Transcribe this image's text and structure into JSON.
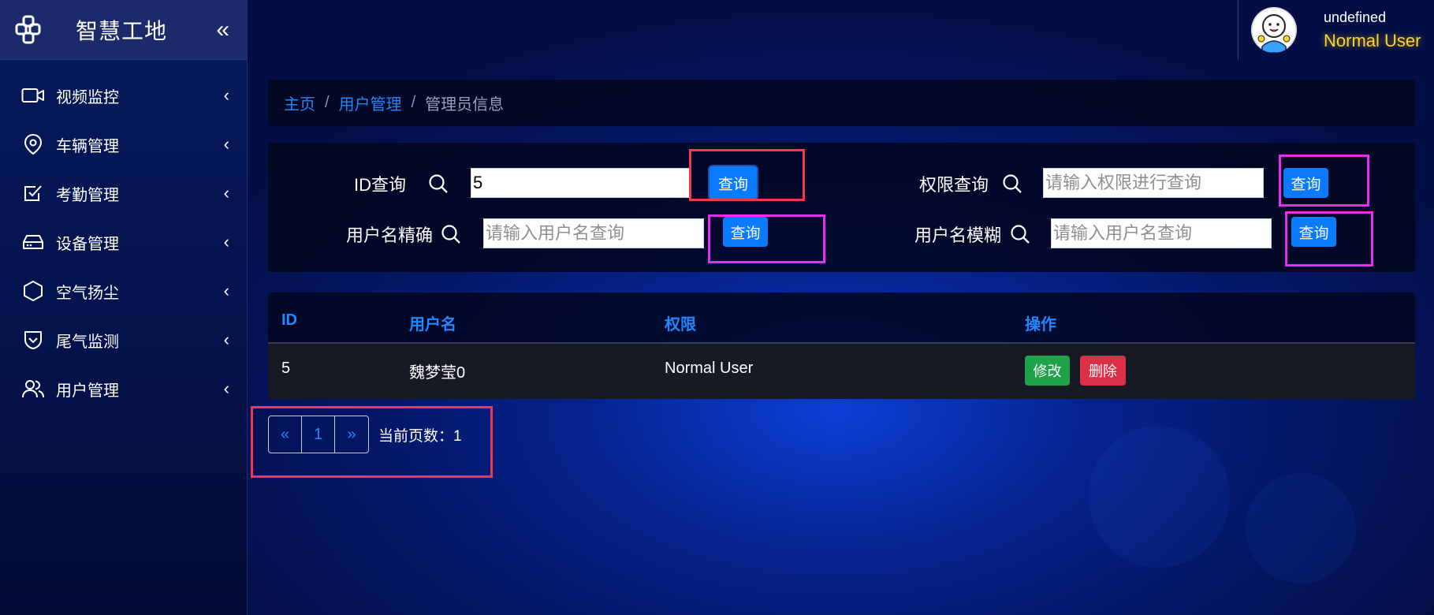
{
  "app": {
    "title": "智慧工地",
    "collapse_symbol": "«",
    "colors": {
      "accent": "#1e88ff",
      "brand_bg": "#1b2a6b",
      "warning": "#ffd42a",
      "success": "#1fa24a",
      "danger": "#dd2e48"
    }
  },
  "sidebar": {
    "items": [
      {
        "label": "视频监控",
        "icon": "video-camera-icon"
      },
      {
        "label": "车辆管理",
        "icon": "location-pin-icon"
      },
      {
        "label": "考勤管理",
        "icon": "checkbox-icon"
      },
      {
        "label": "设备管理",
        "icon": "device-drive-icon"
      },
      {
        "label": "空气扬尘",
        "icon": "hexagon-icon"
      },
      {
        "label": "尾气监测",
        "icon": "shield-check-icon"
      },
      {
        "label": "用户管理",
        "icon": "users-icon"
      }
    ],
    "chevron": "‹"
  },
  "user": {
    "name": "undefined",
    "role": "Normal User",
    "avatar_icon": "cartoon-avatar-icon"
  },
  "breadcrumb": {
    "home": "主页",
    "section": "用户管理",
    "current": "管理员信息",
    "separator": "/"
  },
  "search": {
    "id": {
      "label": "ID查询",
      "value": "5",
      "button": "查询"
    },
    "permission": {
      "label": "权限查询",
      "placeholder": "请输入权限进行查询",
      "button": "查询"
    },
    "username_exact": {
      "label": "用户名精确",
      "placeholder": "请输入用户名查询",
      "button": "查询"
    },
    "username_fuzzy": {
      "label": "用户名模糊",
      "placeholder": "请输入用户名查询",
      "button": "查询"
    }
  },
  "table": {
    "headers": [
      "ID",
      "用户名",
      "权限",
      "操作"
    ],
    "rows": [
      {
        "id": "5",
        "username": "魏梦莹0",
        "permission": "Normal User",
        "edit": "修改",
        "delete": "删除"
      }
    ]
  },
  "pagination": {
    "prev": "«",
    "page": "1",
    "next": "»",
    "info": "当前页数：1"
  }
}
